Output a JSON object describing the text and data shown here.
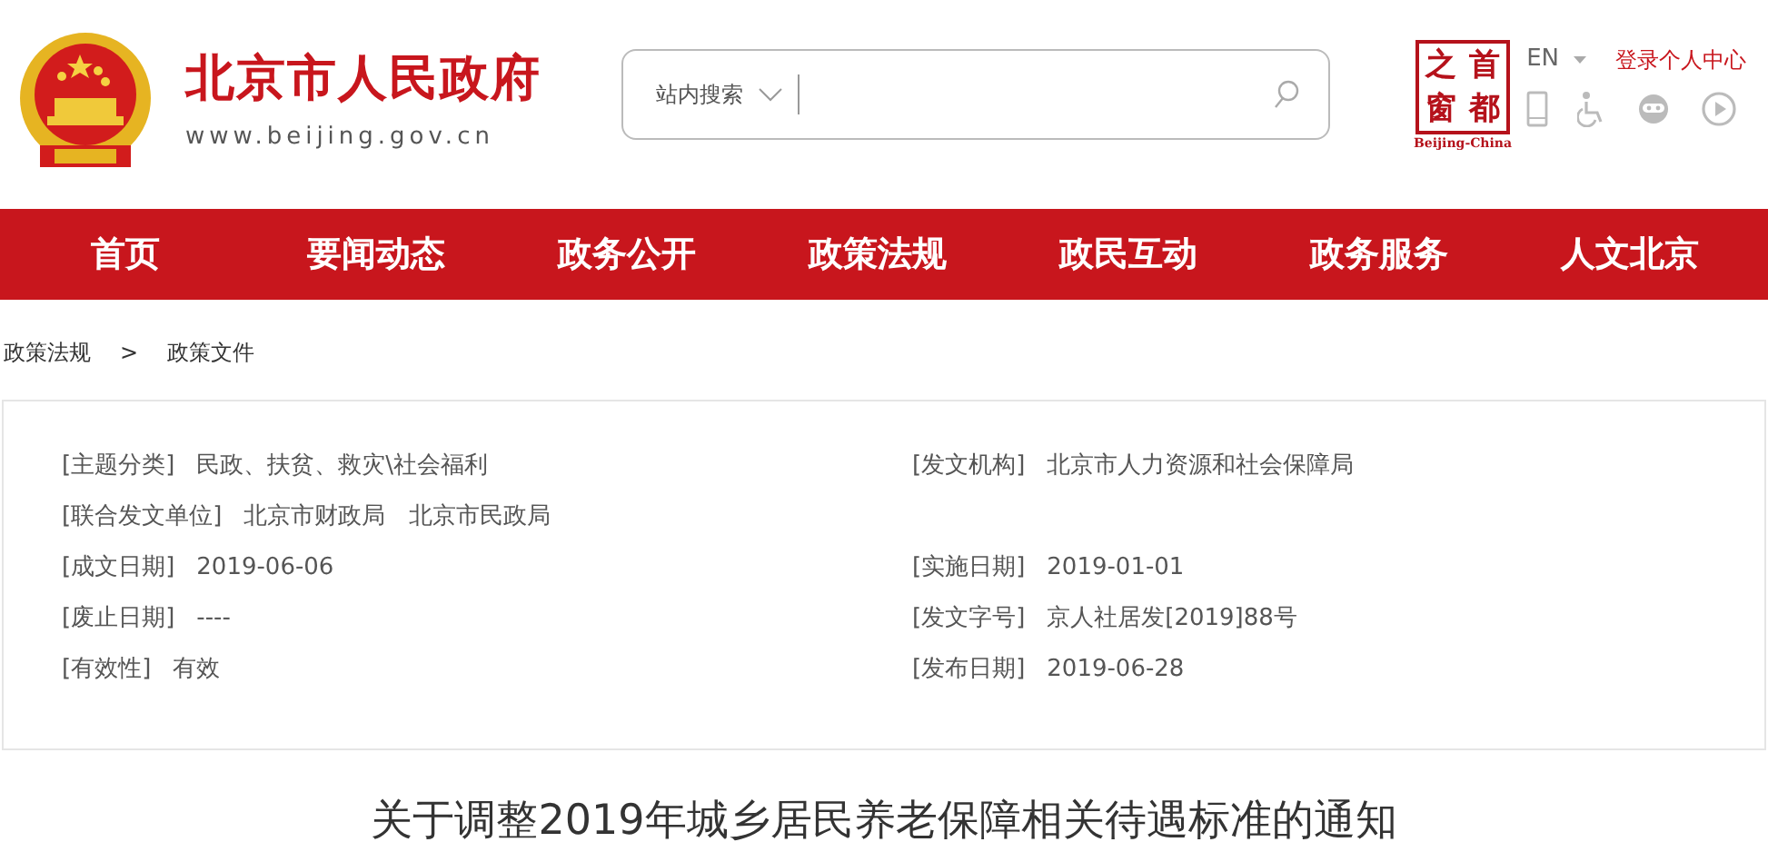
{
  "header": {
    "site_title": "北京市人民政府",
    "site_url": "www.beijing.gov.cn",
    "search": {
      "scope": "站内搜索"
    },
    "brand_caption": "Beijing-China",
    "brand_chars": [
      "之",
      "首",
      "窗",
      "都"
    ],
    "language": "EN",
    "login": "登录个人中心"
  },
  "nav": [
    "首页",
    "要闻动态",
    "政务公开",
    "政策法规",
    "政民互动",
    "政务服务",
    "人文北京"
  ],
  "breadcrumb": [
    "政策法规",
    ">",
    "政策文件"
  ],
  "info_rows": [
    {
      "cells": [
        {
          "label": "[主题分类]",
          "value": "民政、扶贫、救灾\\社会福利"
        },
        {
          "label": "[发文机构]",
          "value": "北京市人力资源和社会保障局"
        }
      ]
    },
    {
      "cells": [
        {
          "label": "[联合发文单位]",
          "value": "北京市财政局　北京市民政局"
        }
      ]
    },
    {
      "cells": [
        {
          "label": "[成文日期]",
          "value": "2019-06-06"
        },
        {
          "label": "[实施日期]",
          "value": "2019-01-01"
        }
      ]
    },
    {
      "cells": [
        {
          "label": "[废止日期]",
          "value": "----"
        },
        {
          "label": "[发文字号]",
          "value": "京人社居发[2019]88号"
        }
      ]
    },
    {
      "cells": [
        {
          "label": "[有效性]",
          "value": "有效"
        },
        {
          "label": "[发布日期]",
          "value": "2019-06-28"
        }
      ]
    }
  ],
  "article_title": "关于调整2019年城乡居民养老保障相关待遇标准的通知"
}
